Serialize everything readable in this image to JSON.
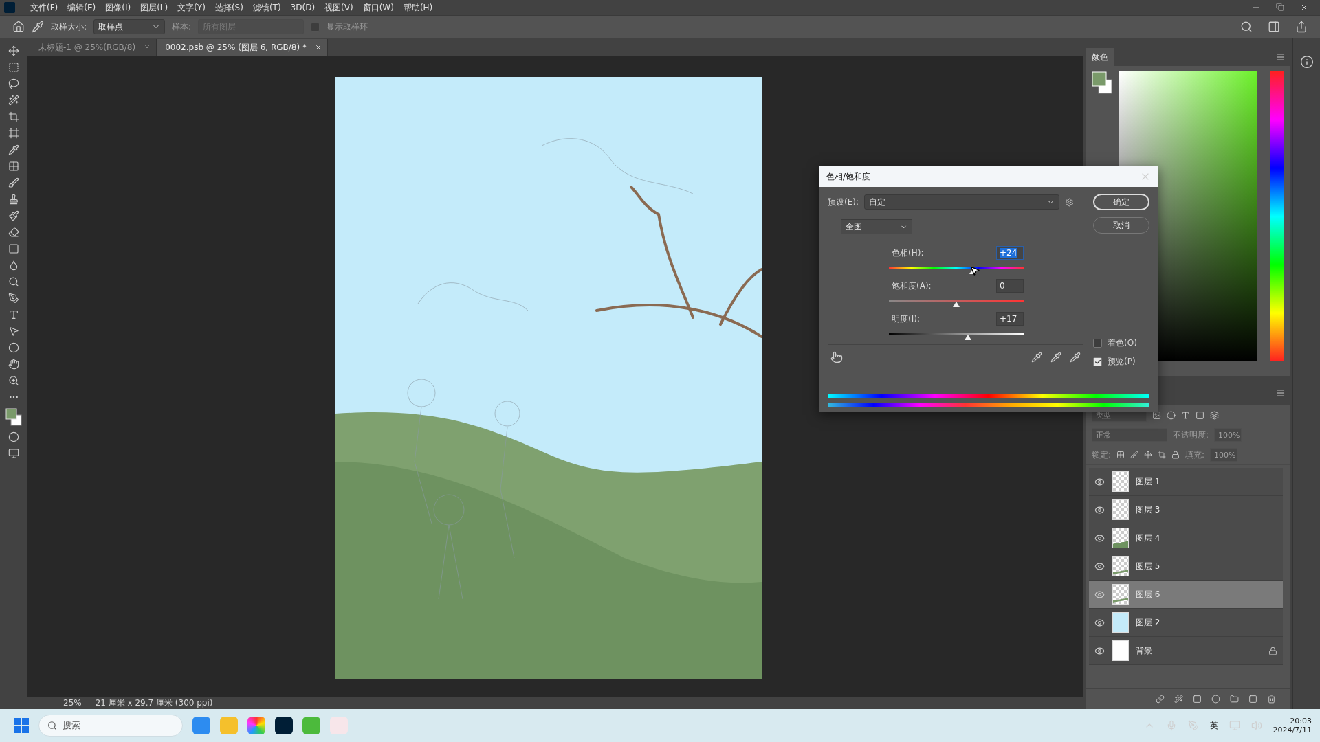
{
  "menu_bar": {
    "items": [
      "文件(F)",
      "编辑(E)",
      "图像(I)",
      "图层(L)",
      "文字(Y)",
      "选择(S)",
      "滤镜(T)",
      "3D(D)",
      "视图(V)",
      "窗口(W)",
      "帮助(H)"
    ]
  },
  "options_bar": {
    "sample_size_label": "取样大小:",
    "sample_size_value": "取样点",
    "sample_label": "样本:",
    "sample_value": "所有图层",
    "sample_disabled": true,
    "show_ring": {
      "label": "显示取样环",
      "checked": false,
      "disabled": true
    }
  },
  "tabs": [
    {
      "label": "未标题-1 @ 25%(RGB/8)",
      "selected": false
    },
    {
      "label": "0002.psb @ 25% (图层 6, RGB/8) *",
      "selected": true
    }
  ],
  "status_bar": {
    "zoom": "25%",
    "document_info": "21 厘米 x 29.7 厘米 (300 ppi)"
  },
  "color_panel": {
    "title": "颜色"
  },
  "layers_panel": {
    "filter_placeholder": "类型",
    "blend_mode": "正常",
    "opacity_label": "不透明度:",
    "opacity_value": "100%",
    "lock_label": "锁定:",
    "fill_label": "填充:",
    "fill_value": "100%",
    "layers": [
      {
        "name": "图层 1",
        "kind": "transparent",
        "visible": true,
        "locked": false,
        "selected": false
      },
      {
        "name": "图层 3",
        "kind": "transparent",
        "visible": true,
        "locked": false,
        "selected": false
      },
      {
        "name": "图层 4",
        "kind": "hill",
        "visible": true,
        "locked": false,
        "selected": false
      },
      {
        "name": "图层 5",
        "kind": "stripe",
        "visible": true,
        "locked": false,
        "selected": false
      },
      {
        "name": "图层 6",
        "kind": "stripe",
        "visible": true,
        "locked": false,
        "selected": true
      },
      {
        "name": "图层 2",
        "kind": "blue",
        "visible": true,
        "locked": false,
        "selected": false
      },
      {
        "name": "背景",
        "kind": "white",
        "visible": true,
        "locked": true,
        "selected": false
      }
    ]
  },
  "dialog": {
    "title": "色相/饱和度",
    "preset_label": "预设(E):",
    "preset_value": "自定",
    "range": "全图",
    "sliders": [
      {
        "kind": "hue",
        "label": "色相(H):",
        "value": "+24",
        "level": 0.62,
        "focused": true
      },
      {
        "kind": "saturation",
        "label": "饱和度(A):",
        "value": "0",
        "level": 0.5,
        "focused": false
      },
      {
        "kind": "lightness",
        "label": "明度(I):",
        "value": "+17",
        "level": 0.585,
        "focused": false
      }
    ],
    "buttons": [
      "确定",
      "取消"
    ],
    "options": [
      {
        "label": "着色(O)",
        "checked": false
      },
      {
        "label": "预览(P)",
        "checked": true
      }
    ]
  },
  "taskbar": {
    "search_placeholder": "搜索",
    "input_method": "英",
    "time": "20:03",
    "date": "2024/7/11"
  }
}
